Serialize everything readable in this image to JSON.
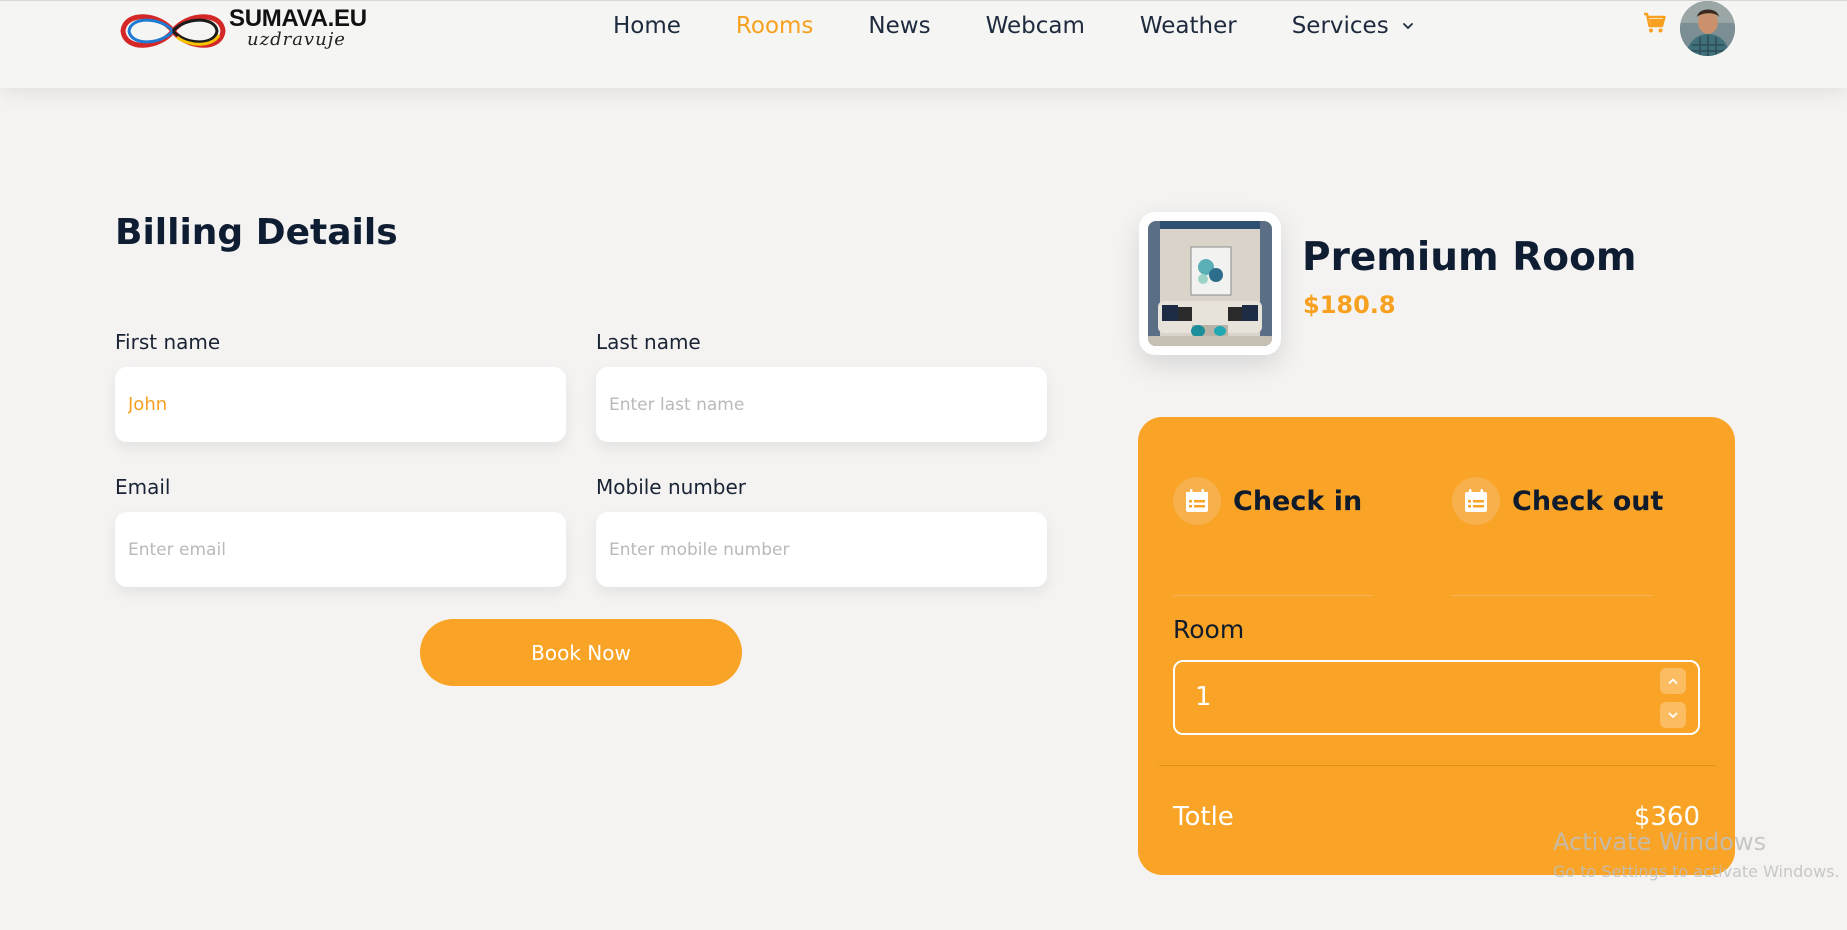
{
  "brand": {
    "name": "SUMAVA.EU",
    "tagline": "uzdravuje"
  },
  "nav": {
    "items": [
      {
        "label": "Home",
        "active": false
      },
      {
        "label": "Rooms",
        "active": true
      },
      {
        "label": "News",
        "active": false
      },
      {
        "label": "Webcam",
        "active": false
      },
      {
        "label": "Weather",
        "active": false
      },
      {
        "label": "Services",
        "active": false,
        "dropdown": true
      }
    ],
    "cart_icon": "shopping-cart-icon",
    "avatar_icon": "user-avatar"
  },
  "billing": {
    "title": "Billing Details",
    "first_name": {
      "label": "First name",
      "value": "John",
      "placeholder": ""
    },
    "last_name": {
      "label": "Last name",
      "value": "",
      "placeholder": "Enter last name"
    },
    "email": {
      "label": "Email",
      "value": "",
      "placeholder": "Enter email"
    },
    "mobile": {
      "label": "Mobile number",
      "value": "",
      "placeholder": "Enter mobile number"
    },
    "submit_label": "Book Now"
  },
  "room": {
    "name": "Premium Room",
    "price": "$180.8"
  },
  "booking": {
    "check_in_label": "Check in",
    "check_out_label": "Check out",
    "room_label": "Room",
    "room_qty": "1",
    "total_label": "Totle",
    "total_value": "$360"
  },
  "watermark": {
    "line1": "Activate Windows",
    "line2": "Go to Settings to activate Windows."
  },
  "colors": {
    "accent": "#f9a426",
    "active_nav": "#f8a020",
    "heading": "#0f1d33",
    "background": "#f4f3f2"
  }
}
